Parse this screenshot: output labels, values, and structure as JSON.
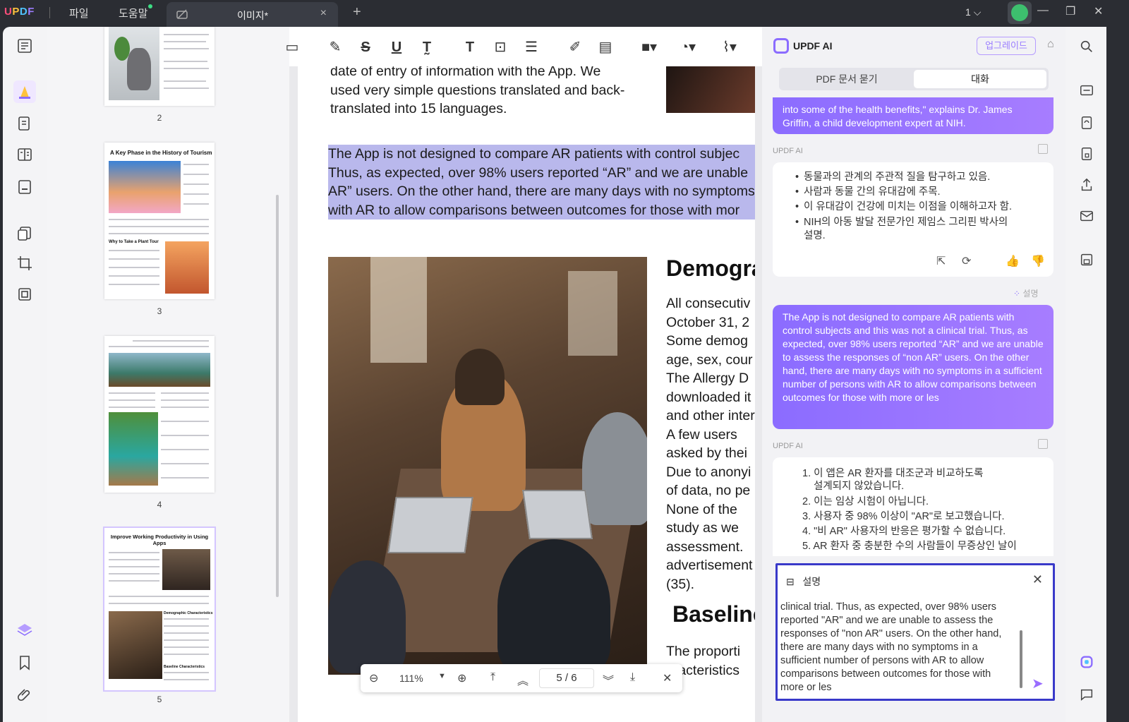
{
  "app": {
    "brand": "UPDF",
    "menus": [
      "파일",
      "도움말"
    ],
    "tab_title": "이미지*",
    "page_count": "1",
    "tab_close": "×",
    "new_tab": "+"
  },
  "thumbnails": [
    {
      "num": "2"
    },
    {
      "num": "3",
      "title": "A Key Phase in the History of Tourism",
      "sub": "Why to Take a Plant Tour"
    },
    {
      "num": "4"
    },
    {
      "num": "5",
      "title": "Improve Working Productivity in Using Apps",
      "sub": "Demographic Characteristics",
      "sub2": "Baseline Characteristics"
    }
  ],
  "document": {
    "top_lines": [
      "date of entry of information with the App. We",
      "used very simple questions translated and back-",
      "translated into 15 languages."
    ],
    "highlight_lines": [
      "The App is not designed to compare AR patients with control subjec",
      "Thus, as expected, over 98% users reported “AR” and we are unable",
      "AR” users. On the other hand, there are many days with no symptoms",
      "with AR to allow comparisons between outcomes for those with mor"
    ],
    "heading1": "Demogra",
    "col_lines": [
      "All consecutiv",
      "October 31, 2",
      "Some demog",
      "age, sex, cour",
      "The Allergy D",
      "downloaded it",
      "and other inter",
      "A few users",
      "asked by thei",
      "Due to anonyi",
      "of data, no pe",
      "None of the",
      "study as we",
      "assessment.",
      "advertisement",
      "(35)."
    ],
    "heading2": "Baseline",
    "bottom_lines": [
      "The proporti",
      "aracteristics"
    ]
  },
  "zoombar": {
    "zoom": "111%",
    "page": "5  /  6"
  },
  "ai": {
    "title": "UPDF AI",
    "upgrade": "업그레이드",
    "tabs": [
      "PDF 문서 묻기",
      "대화"
    ],
    "user_msg1": "into some of the health benefits,\" explains Dr. James Griffin, a child development expert at NIH.",
    "ai_label": "UPDF AI",
    "bullets": [
      "동물과의 관계의 주관적 질을 탐구하고 있음.",
      "사람과 동물 간의 유대감에 주목.",
      "이 유대감이 건강에 미치는 이점을 이해하고자 함.",
      "NIH의 아동 발달 전문가인 제임스 그리핀 박사의",
      "설명."
    ],
    "explain_tag": "설명",
    "user_msg2": "The App is not designed to compare AR patients with control subjects and this was not a clinical trial. Thus, as expected, over 98% users reported “AR” and we are unable to assess the responses of “non AR” users. On the other hand, there are many days with no symptoms in a sufficient number of persons with AR to allow comparisons between outcomes for those with more or les",
    "numbered": [
      "1. 이 앱은 AR 환자를 대조군과 비교하도록",
      "설계되지 않았습니다.",
      "2. 이는 임상 시험이 아닙니다.",
      "3. 사용자 중 98% 이상이 \"AR\"로 보고했습니다.",
      "4. \"비 AR\" 사용자의 반응은 평가할 수 없습니다.",
      "5. AR 환자 중 충분한 수의 사람들이 무증상인 날이"
    ],
    "input_header": "설명",
    "input_text": "clinical trial. Thus, as expected, over 98% users reported \"AR\" and we are unable to assess the responses of \"non AR\" users. On the other hand, there are many days with no symptoms in a sufficient number of persons with AR to allow comparisons between outcomes for those with more or les"
  },
  "colors": {
    "accent": "#8b6cff",
    "highlight": "#b9b8ec",
    "input_border": "#3939c9"
  }
}
